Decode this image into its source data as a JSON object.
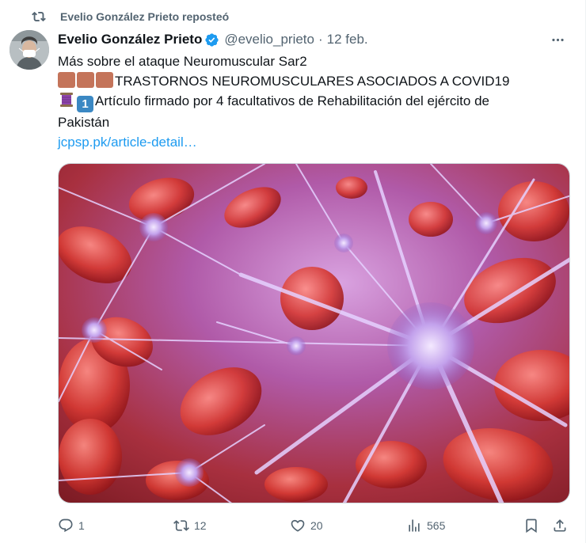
{
  "repost": {
    "text": "Evelio González Prieto reposteó",
    "icon": "repost-icon"
  },
  "author": {
    "name": "Evelio González Prieto",
    "handle": "@evelio_prieto",
    "separator": "·",
    "date": "12 feb.",
    "verified": true,
    "verified_color": "#1d9bf0"
  },
  "tweet": {
    "line1": "Más sobre el ataque Neuromuscular Sar2",
    "line2_emoji": [
      "brown-square",
      "brown-square",
      "brown-square"
    ],
    "line2": "TRASTORNOS NEUROMUSCULARES ASOCIADOS A COVID19",
    "line3_emoji": [
      "thread-spool",
      "keycap-1"
    ],
    "keycap": "1",
    "line3": "Artículo firmado por 4 facultativos de Rehabilitación del ejército de",
    "line4": "Pakistán",
    "link": "jcpsp.pk/article-detail…"
  },
  "media": {
    "icon": "neurons-image"
  },
  "actions": {
    "replies": "1",
    "reposts": "12",
    "likes": "20",
    "views": "565"
  },
  "colors": {
    "text": "#0f1419",
    "secondary": "#536471",
    "link": "#1d9bf0"
  }
}
